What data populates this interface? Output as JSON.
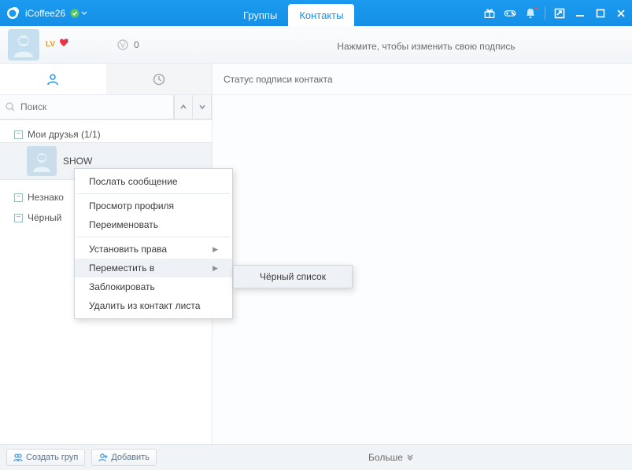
{
  "titlebar": {
    "username": "iCoffee26"
  },
  "nav": {
    "groups_label": "Группы",
    "contacts_label": "Контакты"
  },
  "profile": {
    "lv_label": "LV",
    "coin_count": "0"
  },
  "signature_hint": "Нажмите, чтобы изменить свою подпись",
  "right_header": "Статус подписи контакта",
  "search": {
    "placeholder": "Поиск"
  },
  "tree": {
    "my_friends_label": "Мои друзья (1/1)",
    "contact_name": "SHOW",
    "strangers_label": "Незнако",
    "blacklist_label": "Чёрный"
  },
  "bottombar": {
    "create_group": "Создать груп",
    "add": "Добавить",
    "more": "Больше"
  },
  "ctx": {
    "send_message": "Послать сообщение",
    "view_profile": "Просмотр профиля",
    "rename": "Переименовать",
    "set_rights": "Установить права",
    "move_to": "Переместить в",
    "block": "Заблокировать",
    "remove": "Удалить из контакт листа",
    "submenu_blacklist": "Чёрный список"
  }
}
